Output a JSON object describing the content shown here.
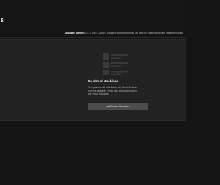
{
  "header": {
    "title": "s"
  },
  "memory": {
    "label": "Available Memory:",
    "text": "24.2.0 GB) • Caution: Allocating too much memory can slow the system or prevent VMs from running"
  },
  "empty_state": {
    "icon": "vm-list-icon",
    "title": "No Virtual Machines",
    "description_lines": [
      "The system could not retrieve any Virtual Machines",
      "from the database. Please click the button below to",
      "add Virtual Machines."
    ],
    "button_label": "Add Virtual Machines"
  },
  "colors": {
    "background": "#141414",
    "panel": "#222222",
    "button": "#4c4c4c",
    "icon": "#3a3a3a"
  }
}
